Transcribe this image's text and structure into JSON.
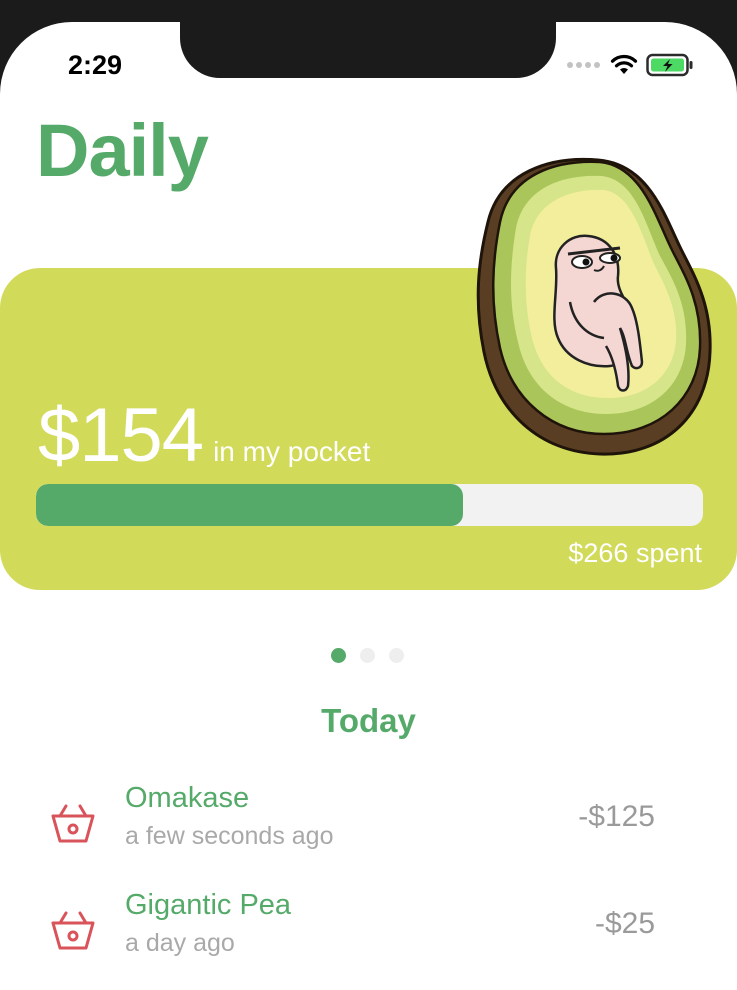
{
  "status_bar": {
    "time": "2:29",
    "icons": [
      "signal-dots-icon",
      "wifi-icon",
      "battery-charging-icon"
    ]
  },
  "header": {
    "title": "Daily"
  },
  "budget_card": {
    "amount": "$154",
    "caption": "in my pocket",
    "spent_label": "$266 spent",
    "progress_fraction": 0.64,
    "card_color": "#d2da5a",
    "progress_color": "#55aa6a",
    "illustration": "avocado-character"
  },
  "pager": {
    "pages": 3,
    "active": 0
  },
  "section": {
    "title": "Today"
  },
  "transactions": [
    {
      "name": "Omakase",
      "time": "a few seconds ago",
      "amount": "-$125",
      "icon": "basket-icon"
    },
    {
      "name": "Gigantic Pea",
      "time": "a day ago",
      "amount": "-$25",
      "icon": "basket-icon"
    }
  ],
  "colors": {
    "accent": "#55aa6a",
    "expense_icon": "#d9535a",
    "muted_text": "#a9a9a9"
  }
}
